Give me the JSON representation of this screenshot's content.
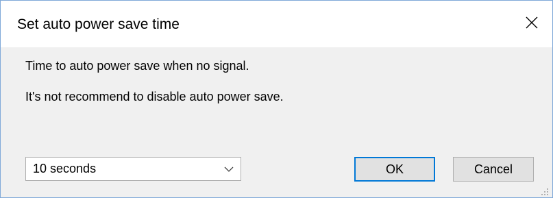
{
  "dialog": {
    "title": "Set auto power save time",
    "message_line1": "Time to auto power save when no signal.",
    "message_line2": "It's not recommend to disable auto power save.",
    "timeout_select": {
      "selected": "10 seconds"
    },
    "ok_label": "OK",
    "cancel_label": "Cancel"
  },
  "icons": {
    "close": "close-icon",
    "dropdown": "chevron-down-icon",
    "grip": "resize-grip-icon"
  },
  "colors": {
    "titlebar_bg": "#ffffff",
    "body_bg": "#f0f0f0",
    "accent": "#0078d7",
    "button_bg": "#e1e1e1"
  }
}
